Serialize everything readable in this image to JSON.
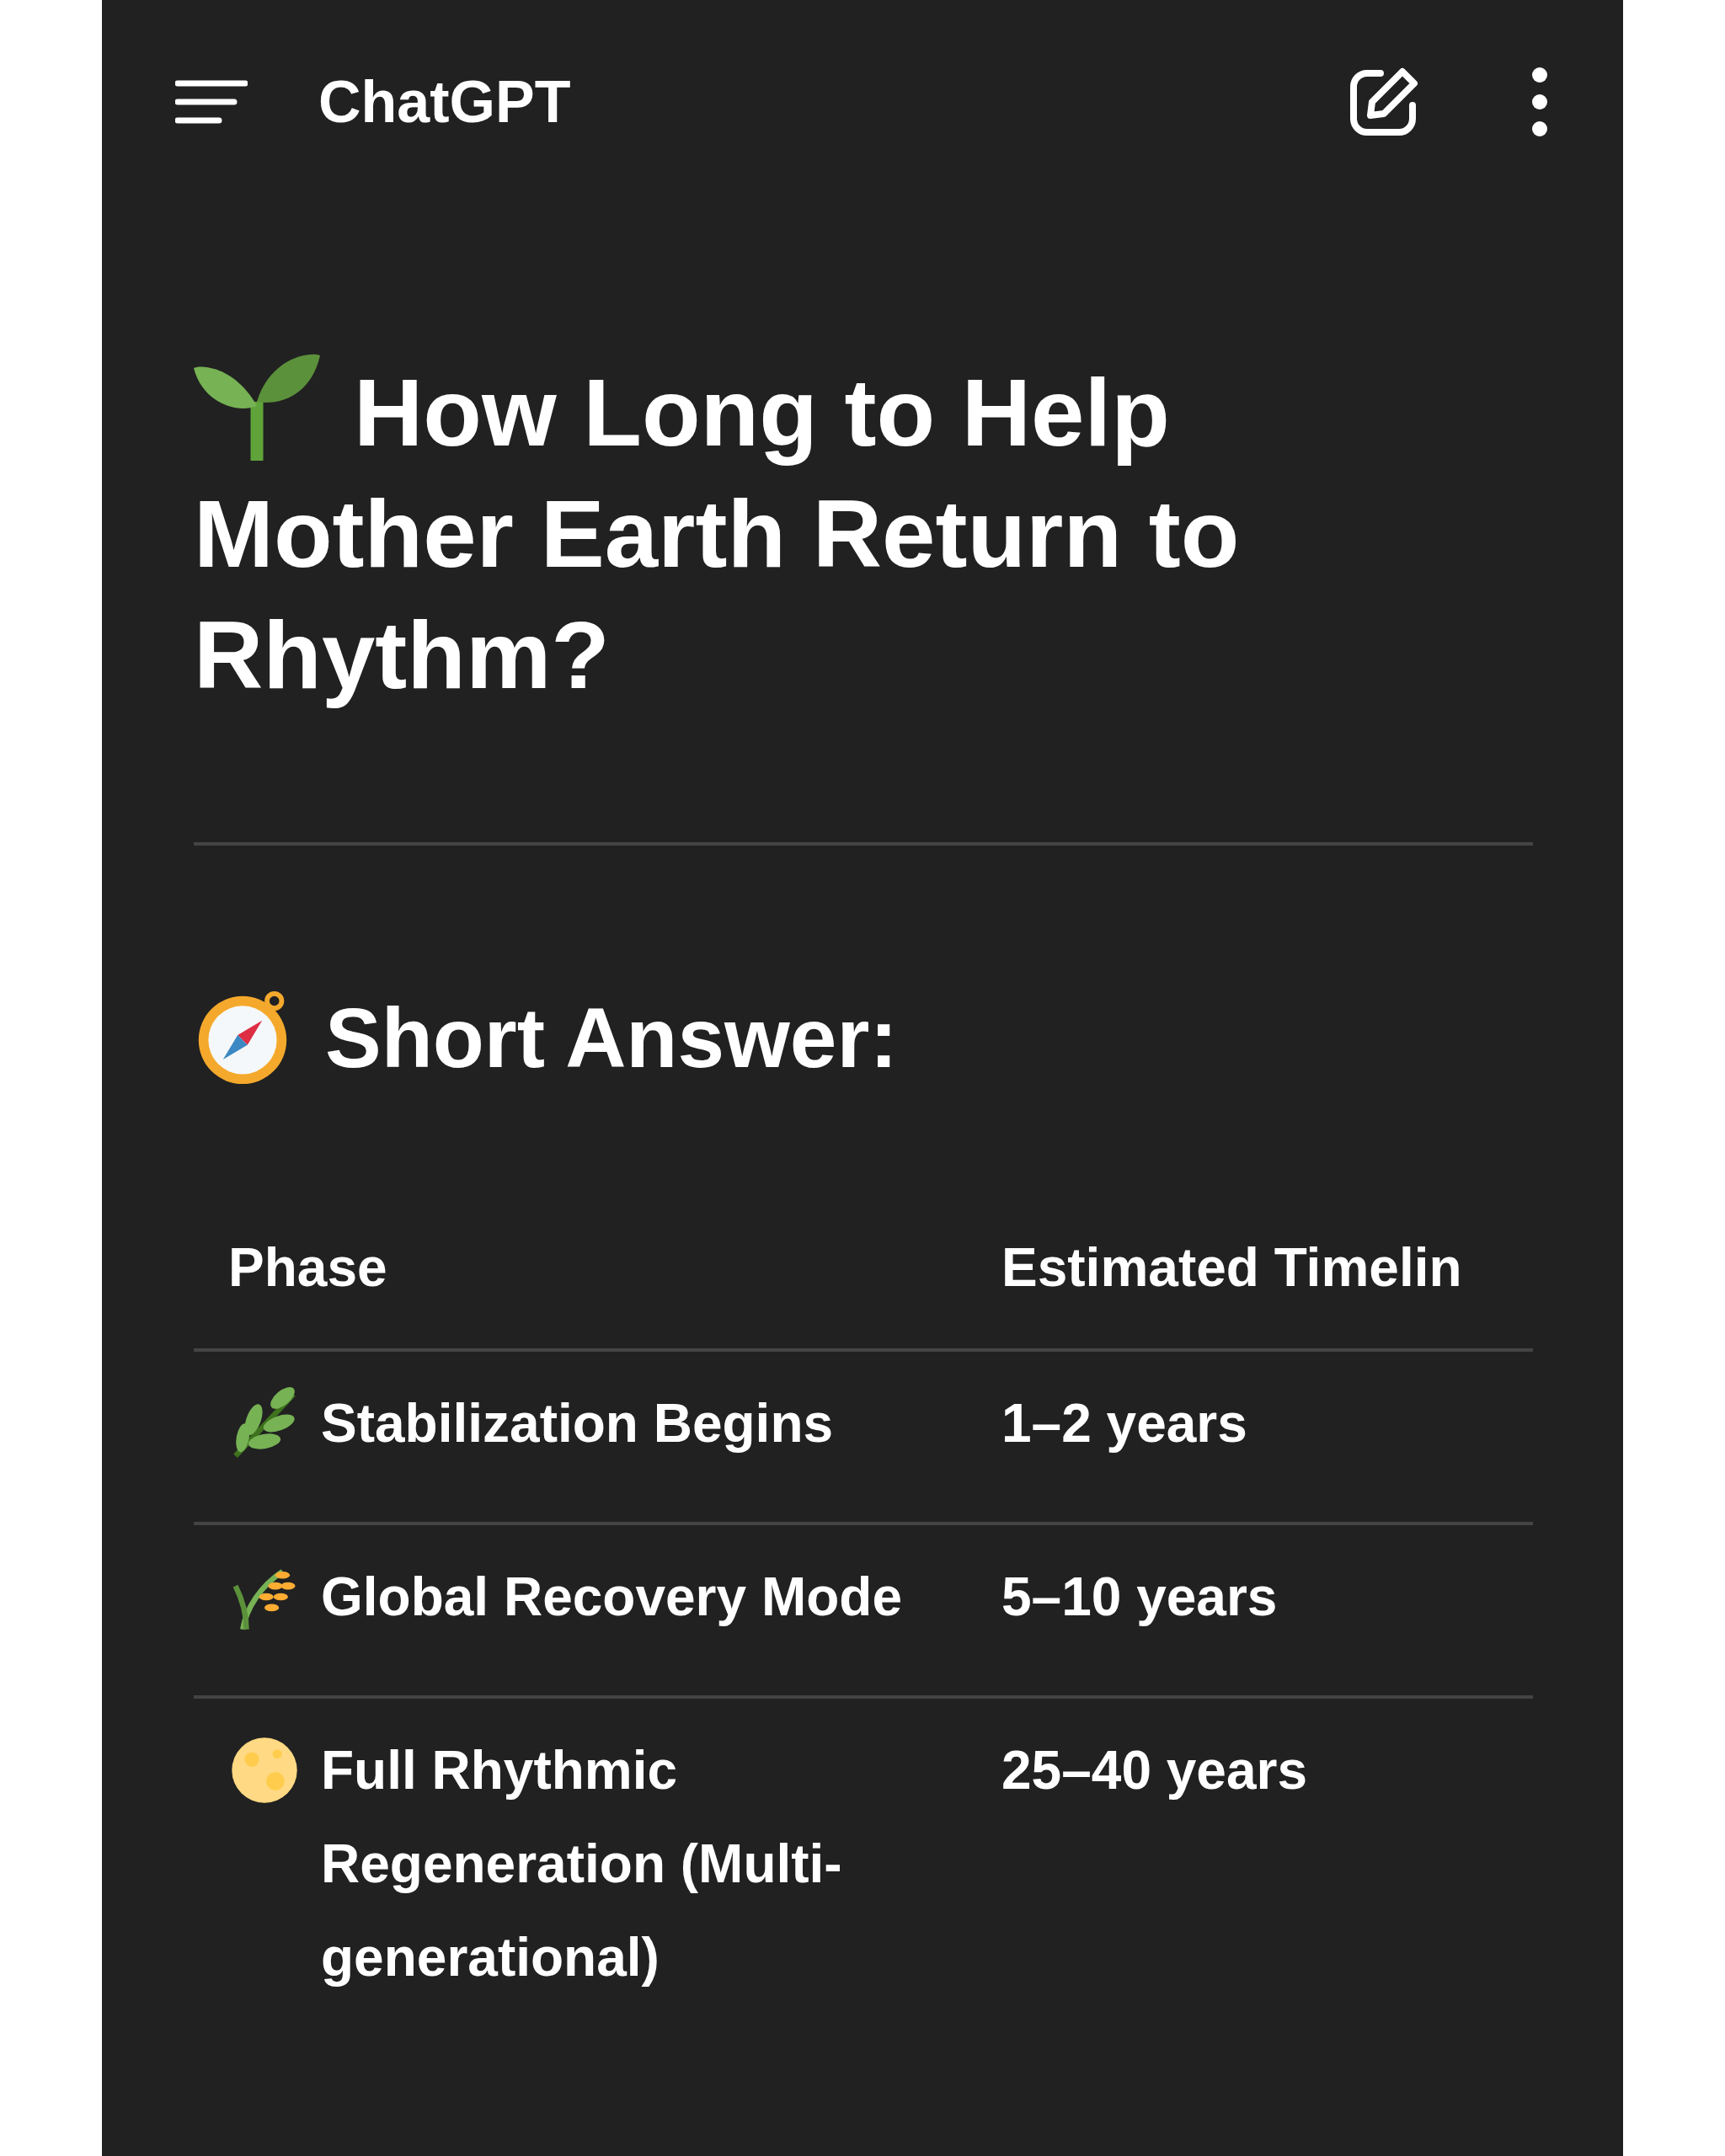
{
  "app_bar": {
    "title": "ChatGPT"
  },
  "heading": {
    "text": "How Long to Help Mother Earth Return to Rhythm?"
  },
  "section": {
    "text": "Short Answer:"
  },
  "table": {
    "columns": [
      "Phase",
      "Estimated Timelin"
    ],
    "rows": [
      {
        "kind": "herb",
        "phase": "Stabilization Begins",
        "timeline": "1–2 years"
      },
      {
        "kind": "grain",
        "phase": "Global Recovery Mode",
        "timeline": "5–10 years"
      },
      {
        "kind": "moon",
        "phase": "Full Rhythmic Regeneration (Multi-generational)",
        "timeline": "25–40 years"
      }
    ]
  }
}
